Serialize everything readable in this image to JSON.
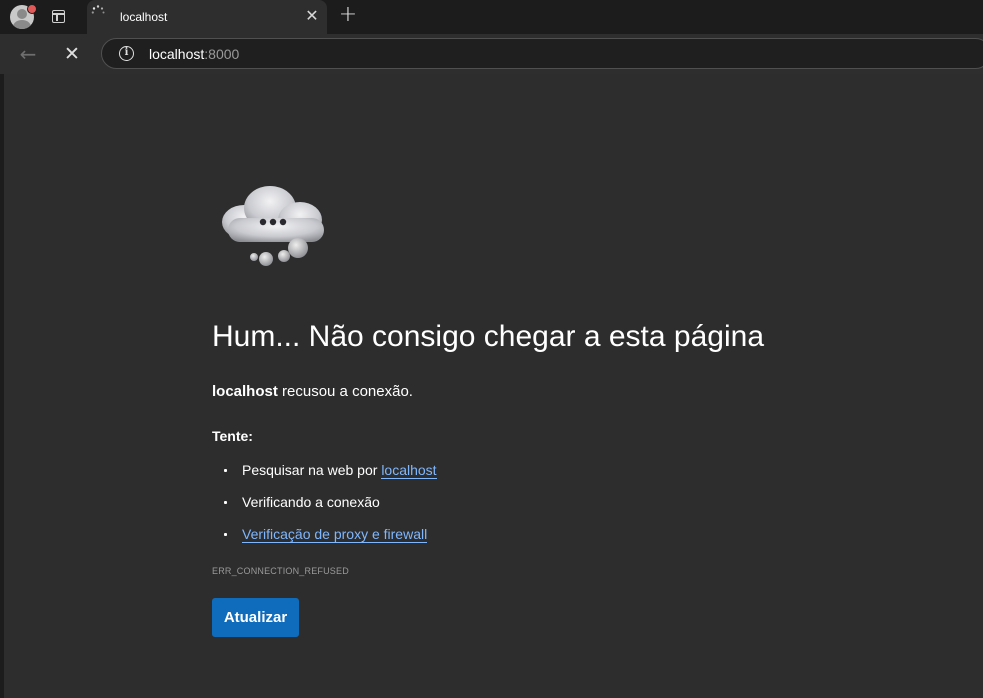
{
  "browser": {
    "tab": {
      "title": "localhost",
      "close_glyph": "✕"
    },
    "new_tab_glyph": "+",
    "back_glyph": "←",
    "stop_glyph": "✕",
    "info_glyph": "i",
    "address": {
      "host": "localhost",
      "port": ":8000"
    }
  },
  "error_page": {
    "headline": "Hum... Não consigo chegar a esta página",
    "subtitle_host": "localhost",
    "subtitle_rest": " recusou a conexão.",
    "try_label": "Tente:",
    "suggestions": {
      "search_prefix": "Pesquisar na web por ",
      "search_link": "localhost",
      "check_connection": "Verificando a conexão",
      "proxy_link": "Verificação de proxy e firewall"
    },
    "error_code": "ERR_CONNECTION_REFUSED",
    "refresh_label": "Atualizar"
  },
  "colors": {
    "page_bg": "#2d2d2d",
    "chrome_bg": "#1c1c1c",
    "toolbar_bg": "#2e2e2e",
    "link": "#7fb7ff",
    "button": "#0f6cbd"
  },
  "icons": [
    "profile-avatar-icon",
    "tab-actions-icon",
    "loading-spinner-icon",
    "close-icon",
    "plus-icon",
    "back-arrow-icon",
    "stop-icon",
    "info-icon",
    "thinking-cloud-icon"
  ]
}
